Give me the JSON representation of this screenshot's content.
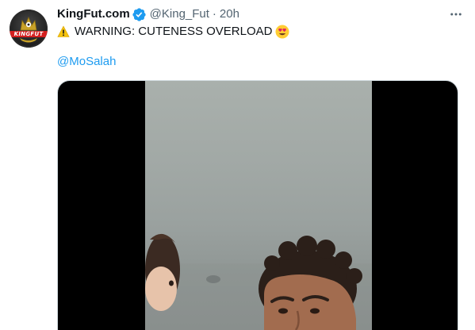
{
  "tweet": {
    "display_name": "KingFut.com",
    "handle": "@King_Fut",
    "separator": "·",
    "time": "20h",
    "text": "WARNING: CUTENESS OVERLOAD",
    "mention": "@MoSalah"
  },
  "avatar": {
    "logo_text": "KINGFUT"
  },
  "icons": {
    "verified": "verified-badge-icon",
    "warning": "warning-icon",
    "emoji": "heart-eyes-emoji-icon",
    "more": "more-options-icon"
  },
  "colors": {
    "link": "#1d9bf0",
    "secondary_text": "#536471",
    "primary_text": "#0f1419",
    "verified": "#1d9bf0"
  }
}
